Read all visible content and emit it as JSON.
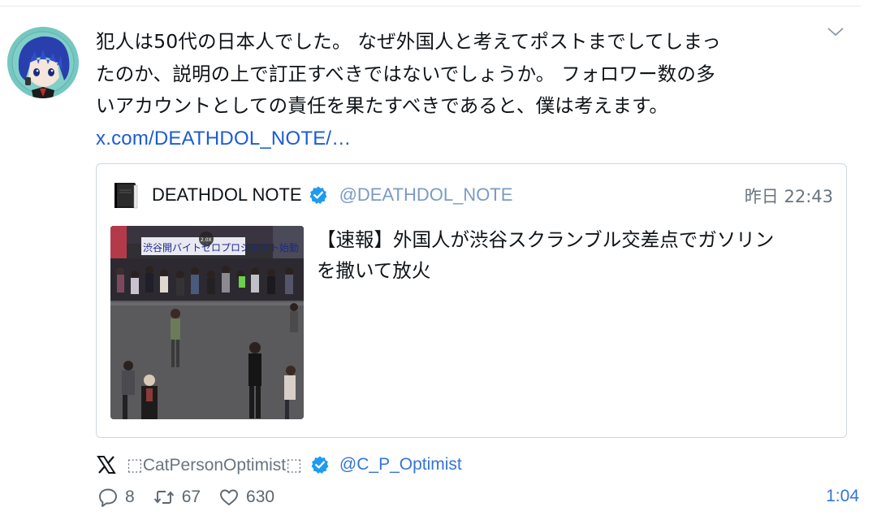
{
  "tweet": {
    "text_lines": [
      "犯人は50代の日本人でした。 なぜ外国人と考えてポストまでしてしまっ",
      "たのか、説明の上で訂正すべきではないでしょうか。 フォロワー数の多",
      "いアカウントとしての責任を果たすべきであると、僕は考えます。"
    ],
    "link": "x.com/DEATHDOL_NOTE/…"
  },
  "quote": {
    "author_name": "DEATHDOL NOTE",
    "author_handle": "@DEATHDOL_NOTE",
    "time": "昨日 22:43",
    "text_lines": [
      "【速報】外国人が渋谷スクランブル交差点でガソリン",
      "を撒いて放火"
    ],
    "media": {
      "banner_text": "渋谷開バイトゼロプロジェクト始動",
      "speed_badge": "2.0X"
    }
  },
  "attribution": {
    "name": "⬚CatPersonOptimist⬚",
    "handle": "@C_P_Optimist"
  },
  "actions": {
    "replies": "8",
    "retweets": "67",
    "likes": "630"
  },
  "timestamp": "1:04",
  "colors": {
    "link": "#1c5bd6",
    "handle": "#3575d8",
    "verified": "#1d9bf0",
    "muted": "#6a7580",
    "border": "#cfd9de"
  },
  "icons": [
    "more-chevron-icon",
    "verified-badge-icon",
    "x-logo-icon",
    "reply-icon",
    "retweet-icon",
    "like-icon"
  ]
}
